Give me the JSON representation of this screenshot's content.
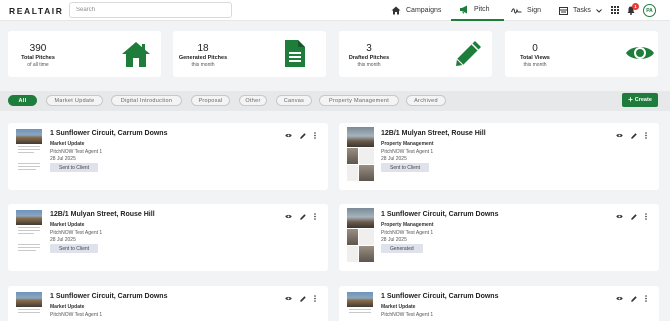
{
  "brand": {
    "logo_text": "REALTAIR",
    "accent": "#1e7d3a"
  },
  "search": {
    "placeholder": "Search"
  },
  "nav": {
    "campaigns": "Campaigns",
    "pitch": "Pitch",
    "sign": "Sign",
    "tasks": "Tasks",
    "notification_count": "1",
    "avatar_initials": "PA"
  },
  "stats": [
    {
      "value": "390",
      "label": "Total Pitches",
      "sub": "of all time",
      "icon": "house-icon"
    },
    {
      "value": "18",
      "label": "Generated Pitches",
      "sub": "this month",
      "icon": "document-icon"
    },
    {
      "value": "3",
      "label": "Drafted Pitches",
      "sub": "this month",
      "icon": "pencil-icon"
    },
    {
      "value": "0",
      "label": "Total Views",
      "sub": "this month",
      "icon": "eye-icon"
    }
  ],
  "filters": {
    "all": "All",
    "market_update": "Market Update",
    "digital_introduction": "Digital Introduction",
    "proposal": "Proposal",
    "other": "Other",
    "canvas": "Canvas",
    "property_management": "Property Management",
    "archived": "Archived"
  },
  "create_button": "Create",
  "pitches": [
    {
      "title": "1 Sunflower Circuit, Carrum Downs",
      "type": "Market Update",
      "agent": "PitchNOW Test Agent 1",
      "date": "28 Jul 2025",
      "status": "Sent to Client"
    },
    {
      "title": "12B/1 Mulyan Street, Rouse Hill",
      "type": "Property Management",
      "agent": "PitchNOW Test Agent 1",
      "date": "28 Jul 2025",
      "status": "Sent to Client"
    },
    {
      "title": "12B/1 Mulyan Street, Rouse Hill",
      "type": "Market Update",
      "agent": "PitchNOW Test Agent 1",
      "date": "28 Jul 2025",
      "status": "Sent to Client"
    },
    {
      "title": "1 Sunflower Circuit, Carrum Downs",
      "type": "Property Management",
      "agent": "PitchNOW Test Agent 1",
      "date": "28 Jul 2025",
      "status": "Generated"
    },
    {
      "title": "1 Sunflower Circuit, Carrum Downs",
      "type": "Market Update",
      "agent": "PitchNOW Test Agent 1",
      "date": "",
      "status": ""
    },
    {
      "title": "1 Sunflower Circuit, Carrum Downs",
      "type": "Market Update",
      "agent": "PitchNOW Test Agent 1",
      "date": "",
      "status": ""
    }
  ]
}
